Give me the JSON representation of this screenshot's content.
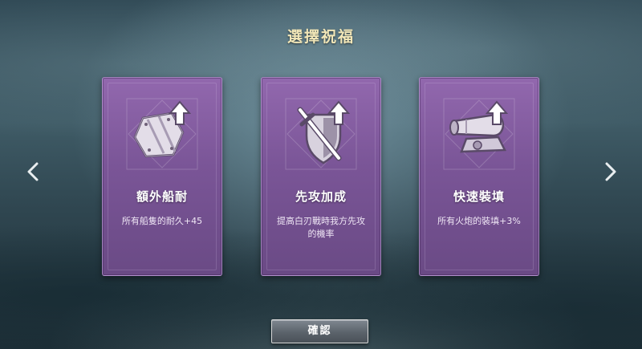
{
  "screen": {
    "title": "選擇祝福"
  },
  "cards": [
    {
      "icon": "reinforced-plate-up-arrow-icon",
      "name": "額外船耐",
      "description": "所有船隻的耐久+45"
    },
    {
      "icon": "sword-shield-up-arrow-icon",
      "name": "先攻加成",
      "description": "提高白刃戰時我方先攻的機率"
    },
    {
      "icon": "cannon-up-arrow-icon",
      "name": "快速裝填",
      "description": "所有火炮的裝填+3%"
    }
  ],
  "navigation": {
    "prev_icon": "chevron-left-icon",
    "next_icon": "chevron-right-icon"
  },
  "confirm_button": {
    "label": "確認"
  },
  "colors": {
    "card_purple": "#7a5597",
    "title_gold": "#f2e7b8",
    "icon_light": "#e6e0ea"
  }
}
